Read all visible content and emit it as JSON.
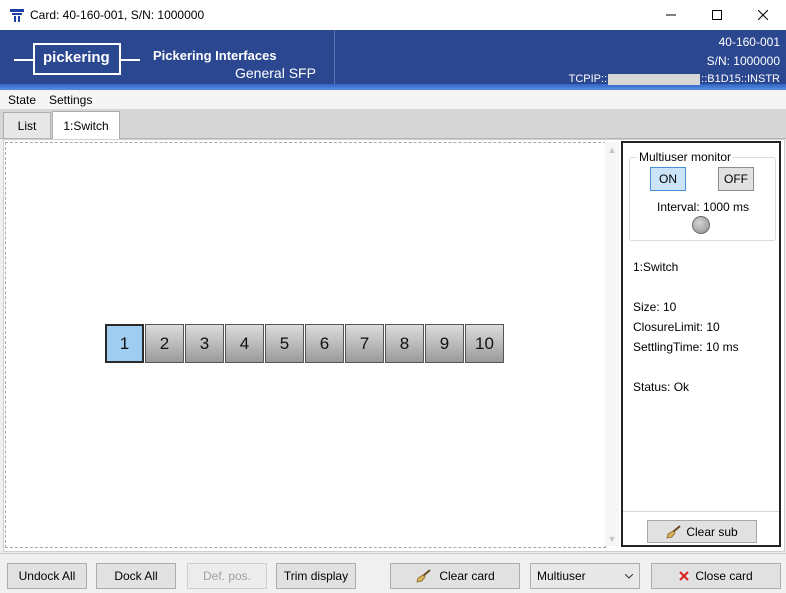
{
  "window": {
    "title": "Card: 40-160-001,  S/N: 1000000"
  },
  "banner": {
    "logo_text": "pickering",
    "company": "Pickering Interfaces",
    "product": "General SFP",
    "card_id": "40-160-001",
    "serial": "S/N: 1000000",
    "visa_prefix": "TCPIP::",
    "visa_suffix": "::B1D15::INSTR"
  },
  "menu": {
    "items": [
      "State",
      "Settings"
    ]
  },
  "tabs": [
    {
      "label": "List"
    },
    {
      "label": "1:Switch"
    }
  ],
  "switch": {
    "channels": [
      "1",
      "2",
      "3",
      "4",
      "5",
      "6",
      "7",
      "8",
      "9",
      "10"
    ],
    "closed": [
      1
    ]
  },
  "multiuser": {
    "title": "Multiuser monitor",
    "on_label": "ON",
    "off_label": "OFF",
    "interval": "Interval: 1000 ms"
  },
  "info": {
    "name": "1:Switch",
    "size": "Size: 10",
    "closure_limit": "ClosureLimit: 10",
    "settling_time": "SettlingTime: 10 ms",
    "status": "Status: Ok"
  },
  "side_actions": {
    "clear_sub": "Clear sub"
  },
  "bottom": {
    "undock_all": "Undock All",
    "dock_all": "Dock All",
    "def_pos": "Def. pos.",
    "trim_display": "Trim display",
    "clear_card": "Clear card",
    "mode": "Multiuser",
    "close_card": "Close card"
  },
  "colors": {
    "banner": "#2b4790",
    "closed_channel": "#9fcdf1",
    "close_icon": "#e02020"
  }
}
